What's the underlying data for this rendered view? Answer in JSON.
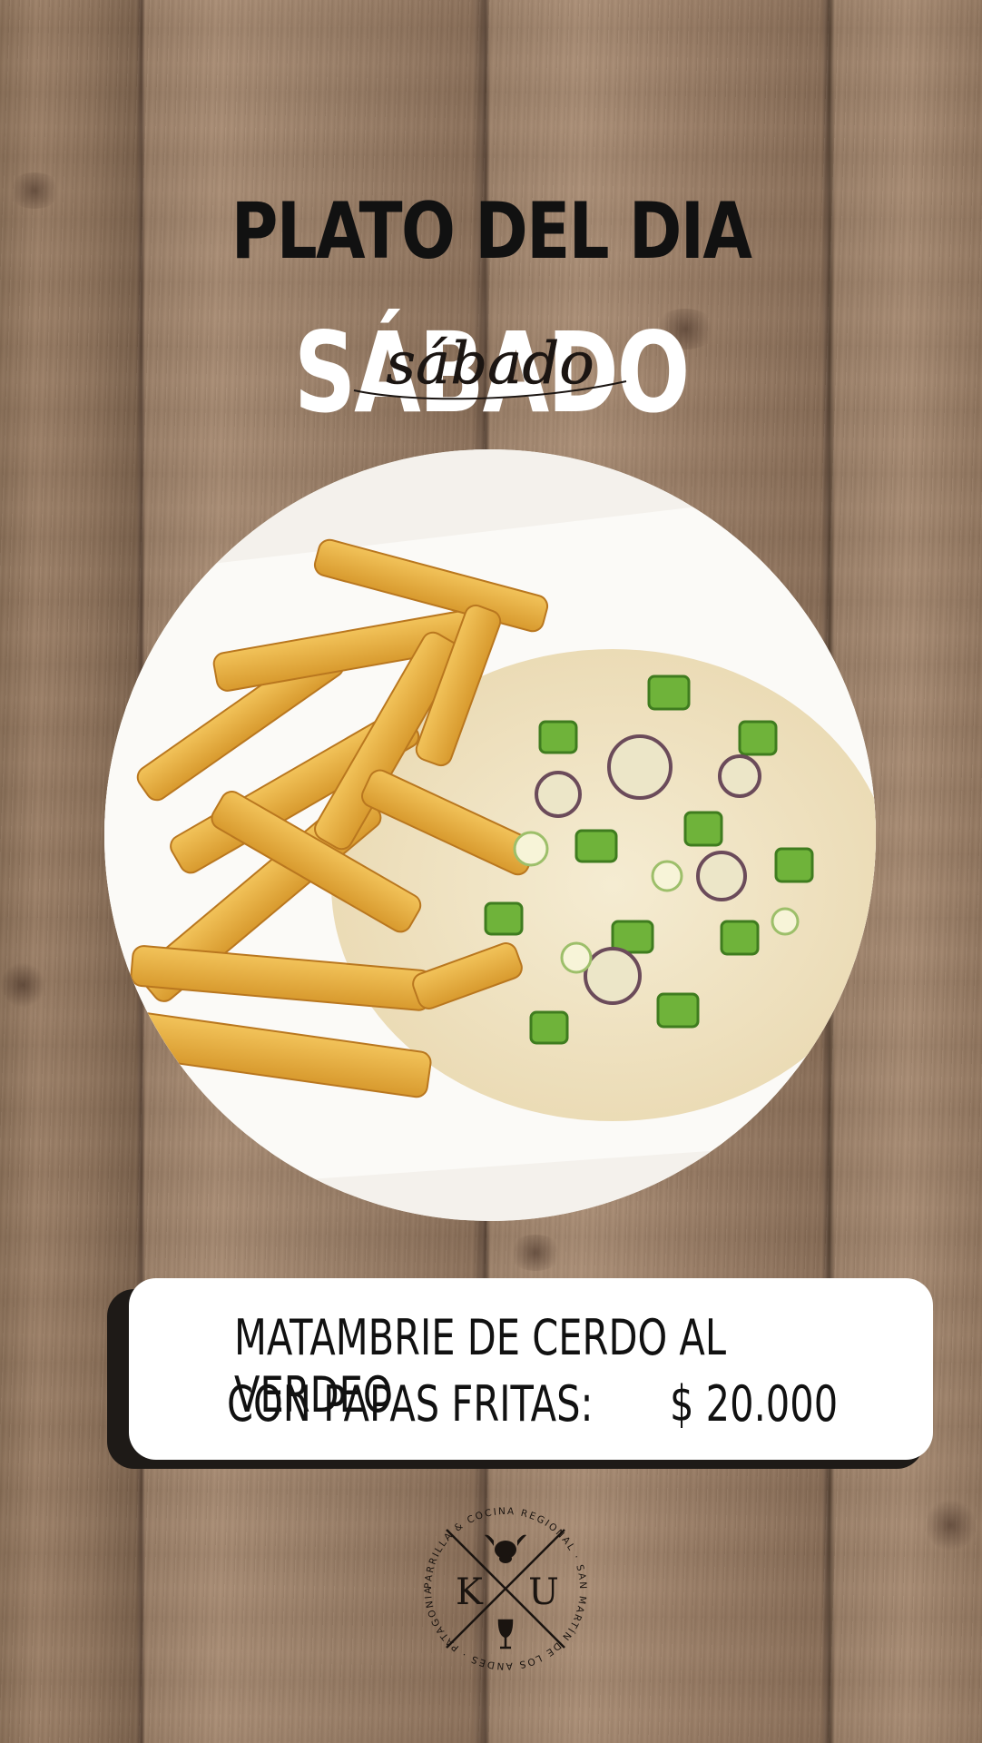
{
  "post": {
    "title": "PLATO DEL DIA",
    "day": "SÁBADO",
    "day_script": "sábado",
    "dish_line1": "MATAMBRIE DE CERDO AL VERDEO",
    "dish_line2": "CON PAPAS FRITAS:",
    "price": "$ 20.000"
  },
  "logo": {
    "ring_text": "PARRILLA & COCINA REGIONAL · SAN MARTÍN DE LOS ANDES · PATAGONIA ·",
    "letter_left": "K",
    "letter_right": "U",
    "icons": [
      "bull-head-icon",
      "wine-glass-icon"
    ]
  },
  "colors": {
    "wood": "#9c8068",
    "title": "#111111",
    "day": "#ffffff",
    "card": "#ffffff",
    "card_shadow": "#1e1a17"
  }
}
